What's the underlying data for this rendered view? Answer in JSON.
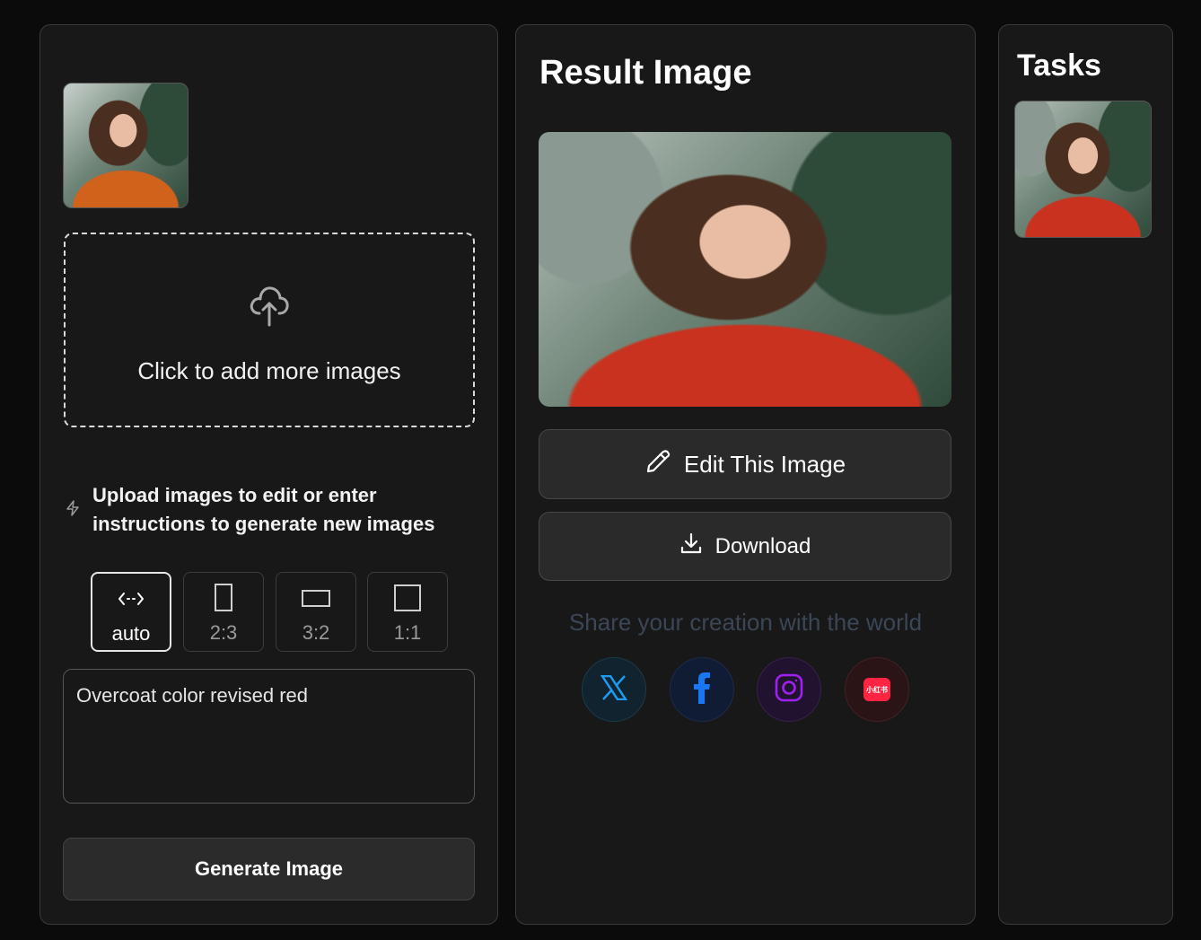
{
  "left": {
    "dropzone_text": "Click to add more images",
    "hint_text": "Upload images to edit or enter instructions to generate new images",
    "ratios": [
      {
        "label": "auto",
        "active": true
      },
      {
        "label": "2:3",
        "active": false
      },
      {
        "label": "3:2",
        "active": false
      },
      {
        "label": "1:1",
        "active": false
      }
    ],
    "prompt_value": "Overcoat color revised red",
    "generate_label": "Generate Image"
  },
  "middle": {
    "title": "Result Image",
    "edit_label": "Edit This Image",
    "download_label": "Download",
    "share_text": "Share your creation with the world",
    "social": [
      {
        "name": "x",
        "color": "#1d9bf0"
      },
      {
        "name": "facebook",
        "color": "#1877f2"
      },
      {
        "name": "instagram",
        "color": "#a020f0"
      },
      {
        "name": "xiaohongshu",
        "color": "#ff2442",
        "badge": "小红书"
      }
    ]
  },
  "right": {
    "title": "Tasks"
  },
  "colors": {
    "background": "#0b0b0c",
    "panel": "#181818",
    "button": "#2b2b2b"
  }
}
